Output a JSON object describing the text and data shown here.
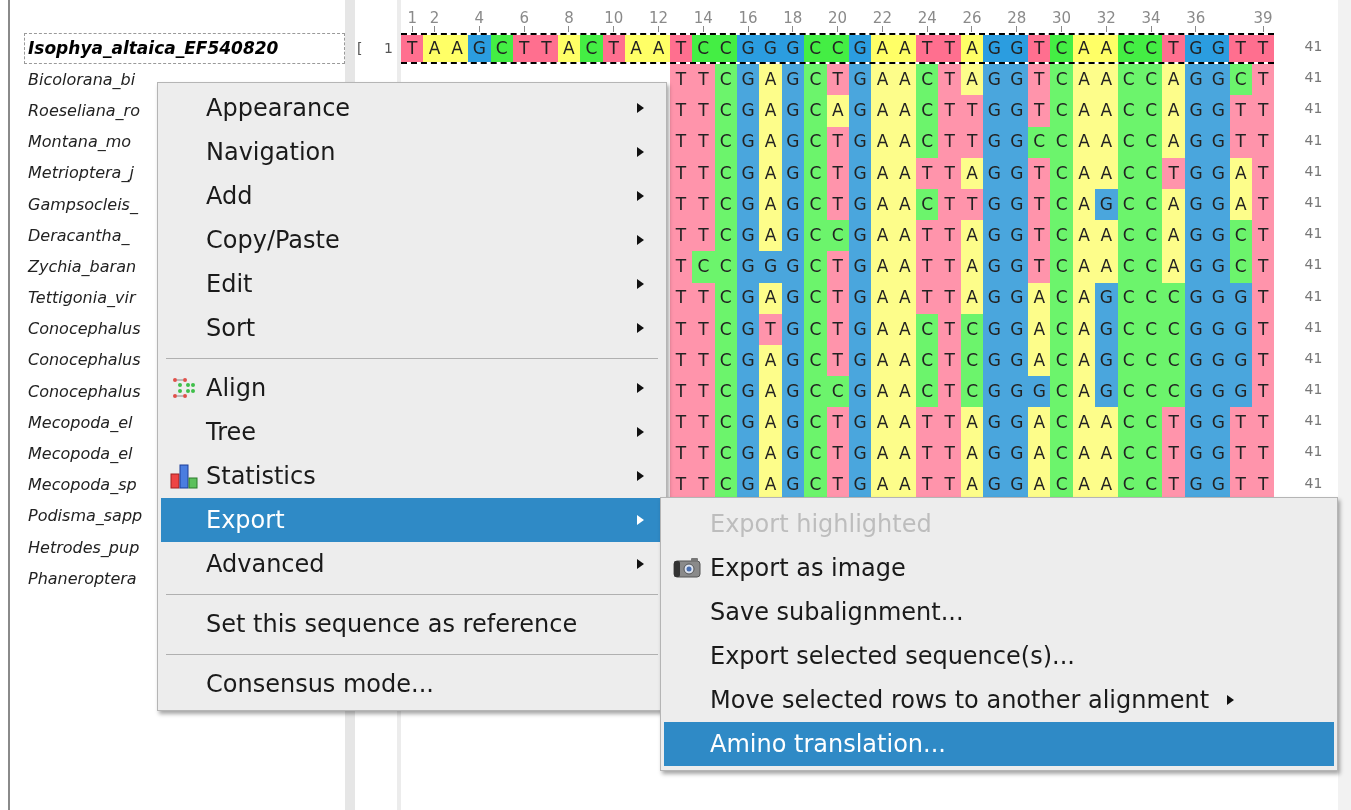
{
  "ruler": {
    "labels": [
      "1",
      "2",
      "4",
      "6",
      "8",
      "10",
      "12",
      "14",
      "16",
      "18",
      "20",
      "22",
      "24",
      "26",
      "28",
      "30",
      "32",
      "34",
      "36",
      "39"
    ]
  },
  "sequences": [
    {
      "name": "Isophya_altaica_EF540820",
      "selected": true,
      "bracket": "[",
      "start": "1",
      "bases": "T A A G C T T A C T A A T C C G G G C C G A A T T A G G T C A A C C T G G T T",
      "length": "41"
    },
    {
      "name": "Bicolorana_bi",
      "selected": false,
      "bases": "T T C G A G C T G A A C T A G G T C A A C C A G G C T",
      "length": "41"
    },
    {
      "name": "Roeseliana_ro",
      "selected": false,
      "bases": "T T C G A G C A G A A C T T G G T C A A C C A G G T T",
      "length": "41"
    },
    {
      "name": "Montana_mo",
      "selected": false,
      "bases": "T T C G A G C T G A A C T T G G C C A A C C A G G T T",
      "length": "41"
    },
    {
      "name": "Metrioptera_j",
      "selected": false,
      "bases": "T T C G A G C T G A A T T A G G T C A A C C T G G A T",
      "length": "41"
    },
    {
      "name": "Gampsocleis_",
      "selected": false,
      "bases": "T T C G A G C T G A A C T T G G T C A G C C A G G A T",
      "length": "41"
    },
    {
      "name": "Deracantha_",
      "selected": false,
      "bases": "T T C G A G C C G A A T T A G G T C A A C C A G G C T",
      "length": "41"
    },
    {
      "name": "Zychia_baran",
      "selected": false,
      "bases": "T C C G G G C T G A A T T A G G T C A A C C A G G C T",
      "length": "41"
    },
    {
      "name": "Tettigonia_vir",
      "selected": false,
      "bases": "T T C G A G C T G A A T T A G G A C A G C C C G G G T",
      "length": "41"
    },
    {
      "name": "Conocephalus",
      "selected": false,
      "bases": "T T C G T G C T G A A C T C G G A C A G C C C G G G T",
      "length": "41"
    },
    {
      "name": "Conocephalus",
      "selected": false,
      "bases": "T T C G A G C T G A A C T C G G A C A G C C C G G G T",
      "length": "41"
    },
    {
      "name": "Conocephalus",
      "selected": false,
      "bases": "T T C G A G C C G A A C T C G G G C A G C C C G G G T",
      "length": "41"
    },
    {
      "name": "Mecopoda_el",
      "selected": false,
      "bases": "T T C G A G C T G A A T T A G G A C A A C C T G G T T",
      "length": "41"
    },
    {
      "name": "Mecopoda_el",
      "selected": false,
      "bases": "T T C G A G C T G A A T T A G G A C A A C C T G G T T",
      "length": "41"
    },
    {
      "name": "Mecopoda_sp",
      "selected": false,
      "bases": "T T C G A G C T G A A T T A G G A C A A C C T G G T T",
      "length": "41"
    },
    {
      "name": "Podisma_sapp",
      "selected": false
    },
    {
      "name": "Hetrodes_pup",
      "selected": false
    },
    {
      "name": "Phaneroptera",
      "selected": false
    }
  ],
  "context_menu": {
    "items": [
      {
        "kind": "item",
        "label": "Appearance",
        "submenu": true,
        "selected": false
      },
      {
        "kind": "item",
        "label": "Navigation",
        "submenu": true,
        "selected": false
      },
      {
        "kind": "item",
        "label": "Add",
        "submenu": true,
        "selected": false
      },
      {
        "kind": "item",
        "label": "Copy/Paste",
        "submenu": true,
        "selected": false
      },
      {
        "kind": "item",
        "label": "Edit",
        "submenu": true,
        "selected": false
      },
      {
        "kind": "item",
        "label": "Sort",
        "submenu": true,
        "selected": false
      },
      {
        "kind": "separator"
      },
      {
        "kind": "item",
        "label": "Align",
        "submenu": true,
        "selected": false
      },
      {
        "kind": "item",
        "label": "Tree",
        "submenu": true,
        "selected": false
      },
      {
        "kind": "item",
        "label": "Statistics",
        "submenu": true,
        "selected": false
      },
      {
        "kind": "item",
        "label": "Export",
        "submenu": true,
        "selected": true
      },
      {
        "kind": "item",
        "label": "Advanced",
        "submenu": true,
        "selected": false
      },
      {
        "kind": "separator"
      },
      {
        "kind": "item",
        "label": "Set this sequence as reference",
        "submenu": false,
        "selected": false
      },
      {
        "kind": "separator"
      },
      {
        "kind": "item",
        "label": "Consensus mode...",
        "submenu": false,
        "selected": false
      }
    ]
  },
  "submenu": {
    "items": [
      {
        "label": "Export highlighted",
        "disabled": true,
        "submenu": false,
        "selected": false
      },
      {
        "label": "Export as image",
        "disabled": false,
        "submenu": false,
        "selected": false
      },
      {
        "label": "Save subalignment...",
        "disabled": false,
        "submenu": false,
        "selected": false
      },
      {
        "label": "Export selected sequence(s)...",
        "disabled": false,
        "submenu": false,
        "selected": false
      },
      {
        "label": "Move selected rows to another alignment",
        "disabled": false,
        "submenu": true,
        "selected": false
      },
      {
        "label": "Amino translation...",
        "disabled": false,
        "submenu": false,
        "selected": true
      }
    ]
  }
}
